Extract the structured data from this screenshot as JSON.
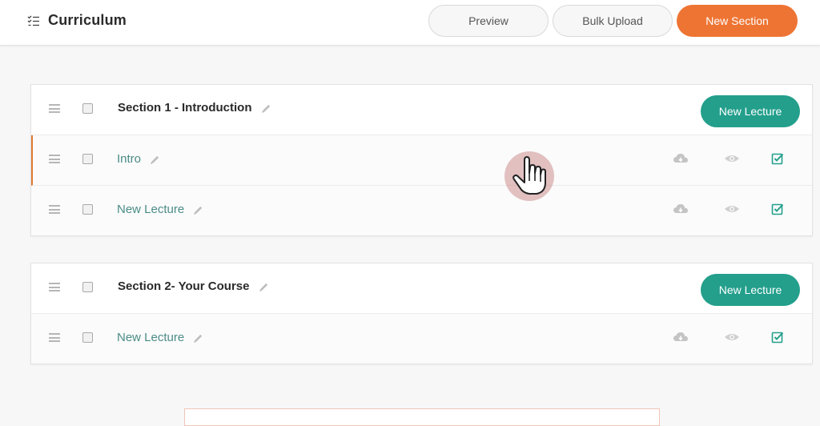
{
  "header": {
    "title": "Curriculum",
    "preview_label": "Preview",
    "bulk_upload_label": "Bulk Upload",
    "new_section_label": "New Section"
  },
  "sections": [
    {
      "title": "Section 1 - Introduction",
      "new_lecture_label": "New Lecture",
      "lectures": [
        {
          "title": "Intro"
        },
        {
          "title": "New Lecture"
        }
      ]
    },
    {
      "title": "Section 2- Your Course",
      "new_lecture_label": "New Lecture",
      "lectures": [
        {
          "title": "New Lecture"
        }
      ]
    }
  ],
  "colors": {
    "accent_orange": "#ee7433",
    "accent_teal": "#239f8c",
    "lecture_text": "#4b8c87"
  },
  "icons": [
    "list-check-icon",
    "drag-handle-icon",
    "pencil-icon",
    "cloud-download-icon",
    "eye-icon",
    "checkbox-checked-icon",
    "hand-cursor-icon"
  ]
}
